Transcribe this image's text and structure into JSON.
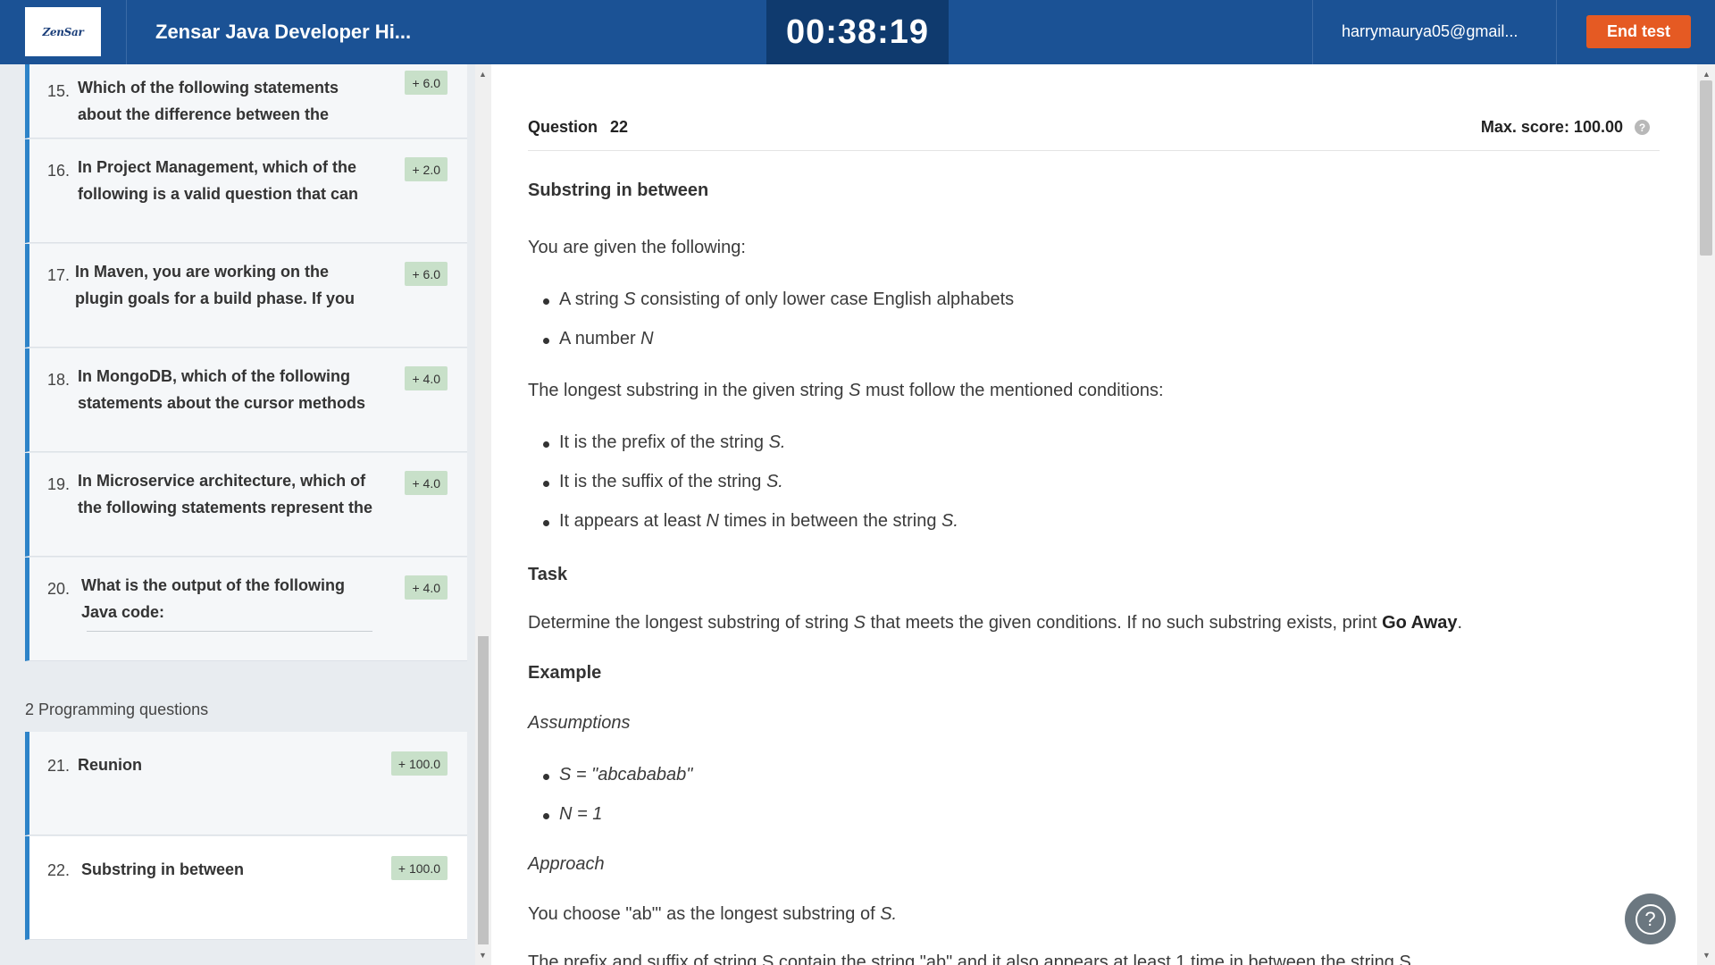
{
  "header": {
    "logo_text": "ZenSar",
    "test_title": "Zensar Java Developer Hi...",
    "timer": "00:38:19",
    "user_email": "harrymaurya05@gmail...",
    "end_test_label": "End test"
  },
  "sidebar": {
    "questions": [
      {
        "num": "15.",
        "text": "Which of the following statements about the difference between the Test-",
        "score": "+ 6.0"
      },
      {
        "num": "16.",
        "text": "In Project Management, which of the following is a valid question that can",
        "score": "+ 2.0"
      },
      {
        "num": "17.",
        "text": "In Maven, you are working on the plugin goals for a build phase. If you",
        "score": "+ 6.0"
      },
      {
        "num": "18.",
        "text": "In MongoDB, which of the following statements about the cursor methods",
        "score": "+ 4.0"
      },
      {
        "num": "19.",
        "text": "In Microservice architecture, which of the following statements represent the",
        "score": "+ 4.0"
      },
      {
        "num": "20.",
        "text": "What is the output of the following Java code:",
        "score": "+ 4.0"
      }
    ],
    "programming_section_label": "2 Programming questions",
    "programming_questions": [
      {
        "num": "21.",
        "text": "Reunion",
        "score": "+ 100.0"
      },
      {
        "num": "22.",
        "text": "Substring in between",
        "score": "+ 100.0"
      }
    ]
  },
  "question": {
    "label": "Question",
    "number": "22",
    "max_score": "Max. score: 100.00",
    "help_icon_glyph": "?",
    "title": "Substring in between",
    "intro": "You are given the following:",
    "given": {
      "string_pre": "A string ",
      "string_var": "S",
      "string_post": " consisting of only lower case English alphabets",
      "number_pre": "A number ",
      "number_var": "N"
    },
    "cond_pre": "The longest substring in the given string ",
    "cond_var": "S",
    "cond_post": " must follow the mentioned conditions:",
    "conditions": [
      {
        "pre": "It is the prefix of the string ",
        "var": "S."
      },
      {
        "pre": "It is the suffix of the string ",
        "var": "S."
      },
      {
        "pre": "It appears at least ",
        "var": "N",
        "mid": " times in between the string ",
        "var2": "S."
      }
    ],
    "task_heading": "Task",
    "task_pre": "Determine the longest substring of string ",
    "task_var": "S",
    "task_mid": " that meets the given conditions. If no such substring exists, print ",
    "task_strong": "Go Away",
    "task_end": ".",
    "example_heading": "Example",
    "assumptions_label": "Assumptions",
    "assumptions": [
      "S = \"abcababab\"",
      "N = 1"
    ],
    "approach_label": "Approach",
    "approach_pre": "You choose \"ab\"' as the longest substring of ",
    "approach_var": "S.",
    "cut_line": "The prefix and suffix of string S contain the string \"ab\" and it also appears at least 1 time in between the string S."
  },
  "help_fab_glyph": "?"
}
